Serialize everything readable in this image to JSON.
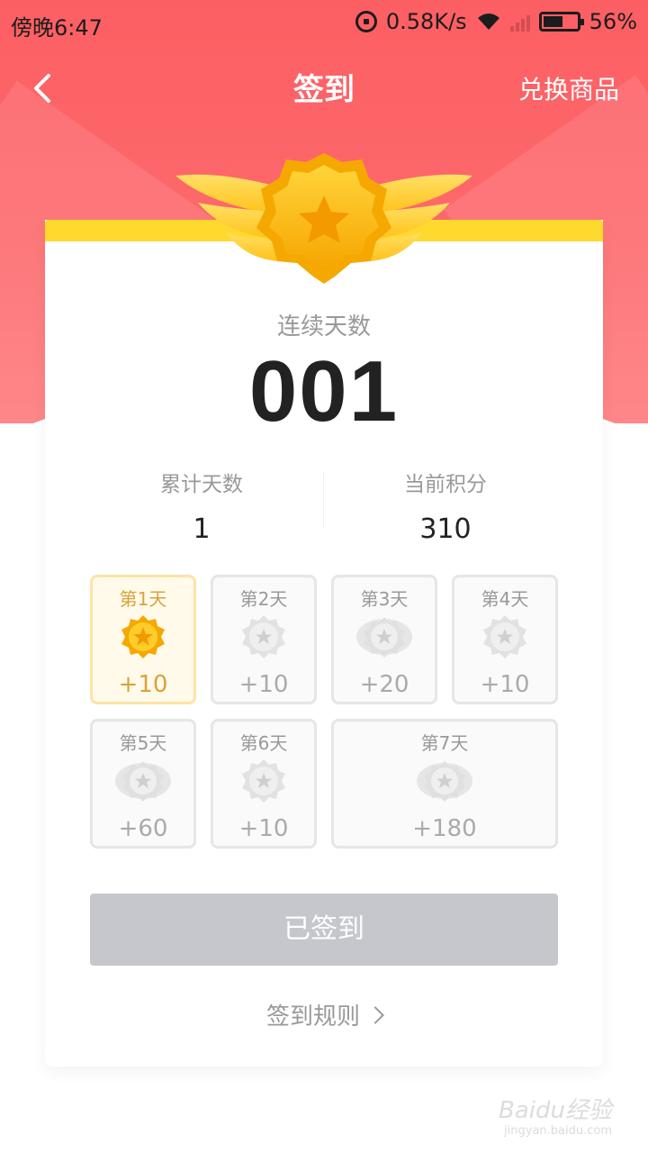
{
  "status_bar": {
    "time": "傍晚6:47",
    "network_speed": "0.58K/s",
    "battery": "56%"
  },
  "nav": {
    "title": "签到",
    "right_label": "兑换商品",
    "back_icon": "chevron-left-icon"
  },
  "streak": {
    "label": "连续天数",
    "value": "001"
  },
  "stats": [
    {
      "label": "累计天数",
      "value": "1"
    },
    {
      "label": "当前积分",
      "value": "310"
    }
  ],
  "days": [
    {
      "label": "第1天",
      "points": "+10",
      "active": true
    },
    {
      "label": "第2天",
      "points": "+10",
      "active": false
    },
    {
      "label": "第3天",
      "points": "+20",
      "active": false
    },
    {
      "label": "第4天",
      "points": "+10",
      "active": false
    },
    {
      "label": "第5天",
      "points": "+60",
      "active": false
    },
    {
      "label": "第6天",
      "points": "+10",
      "active": false
    },
    {
      "label": "第7天",
      "points": "+180",
      "active": false
    }
  ],
  "action": {
    "button_label": "已签到",
    "rules_label": "签到规则"
  },
  "watermark": {
    "brand": "Baidu经验",
    "url": "jingyan.baidu.com"
  },
  "colors": {
    "header": "#fc5f63",
    "accent": "#ffd92e",
    "active_text": "#d9a23a",
    "button_disabled": "#c6c7cc"
  }
}
